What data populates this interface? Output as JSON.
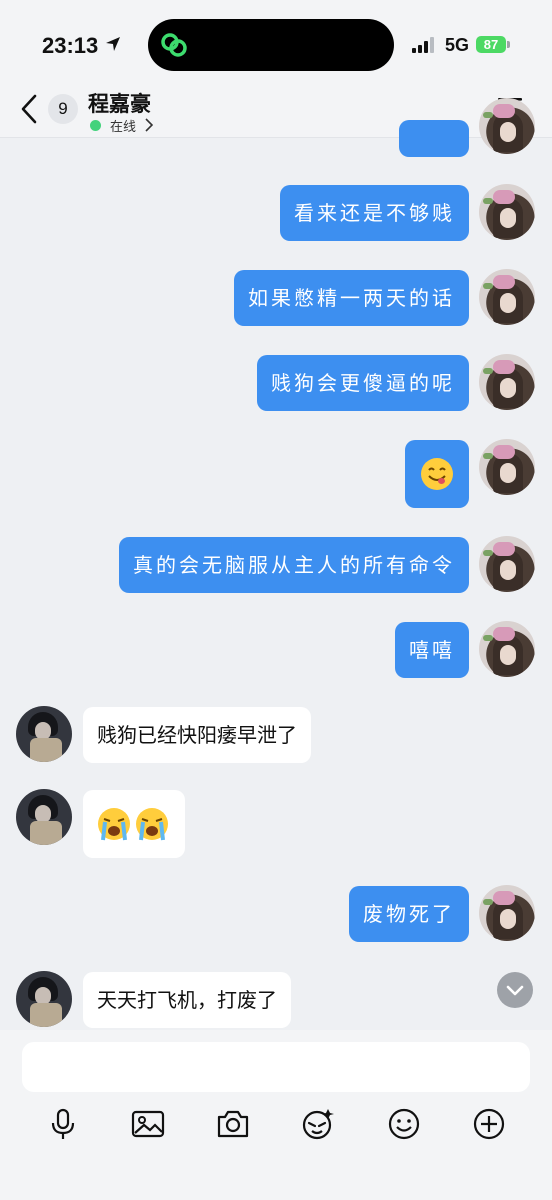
{
  "status_bar": {
    "time": "23:13",
    "network": "5G",
    "battery": "87"
  },
  "header": {
    "unread_count": "9",
    "contact_name": "程嘉豪",
    "status_text": "在线"
  },
  "messages": [
    {
      "side": "out",
      "text": ""
    },
    {
      "side": "out",
      "text": "看来还是不够贱"
    },
    {
      "side": "out",
      "text": "如果憋精一两天的话"
    },
    {
      "side": "out",
      "text": "贱狗会更傻逼的呢"
    },
    {
      "side": "out",
      "emoji": "yum-emoji"
    },
    {
      "side": "out",
      "text": "真的会无脑服从主人的所有命令"
    },
    {
      "side": "out",
      "text": "嘻嘻"
    },
    {
      "side": "in",
      "text": "贱狗已经快阳痿早泄了"
    },
    {
      "side": "in",
      "emoji": "loudly-crying-emoji x2"
    },
    {
      "side": "out",
      "text": "废物死了"
    },
    {
      "side": "in",
      "text": "天天打飞机，打废了"
    }
  ],
  "colors": {
    "outgoing_bubble": "#3d8ff0",
    "incoming_bubble": "#ffffff",
    "background": "#eef0f3",
    "online": "#43d27c",
    "battery": "#4cd964"
  },
  "toolbar": [
    "microphone-icon",
    "image-icon",
    "camera-icon",
    "sticker-icon",
    "emoji-icon",
    "plus-icon"
  ]
}
